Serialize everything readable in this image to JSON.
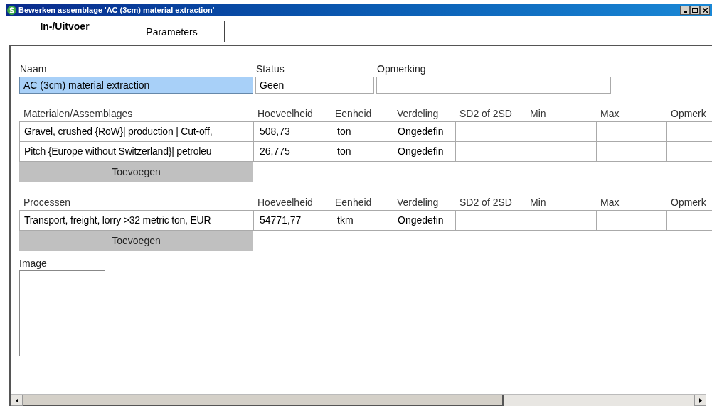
{
  "window": {
    "title": "Bewerken assemblage 'AC (3cm) material extraction'"
  },
  "tabs": [
    {
      "label": "In-/Uitvoer",
      "selected": true
    },
    {
      "label": "Parameters",
      "selected": false
    }
  ],
  "fields": [
    {
      "label": "Naam",
      "value": "AC (3cm) material extraction",
      "selected": true
    },
    {
      "label": "Status",
      "value": "Geen",
      "selected": false
    },
    {
      "label": "Opmerking",
      "selected": false
    }
  ],
  "sections": [
    {
      "columns": [
        "Materialen/Assemblages",
        "Hoeveelheid",
        "Eenheid",
        "Verdeling",
        "SD2 of 2SD",
        "Min",
        "Max",
        "Opmerk"
      ],
      "rows": [
        [
          "Gravel, crushed {RoW}| production | Cut-off,",
          "508,73",
          "ton",
          "Ongedefin"
        ],
        [
          "Pitch {Europe without Switzerland}| petroleu",
          "26,775",
          "ton",
          "Ongedefin"
        ]
      ],
      "button": "Toevoegen"
    },
    {
      "columns": [
        "Processen",
        "Hoeveelheid",
        "Eenheid",
        "Verdeling",
        "SD2 of 2SD",
        "Min",
        "Max",
        "Opmerk"
      ],
      "rows": [
        [
          "Transport, freight, lorry >32 metric ton, EUR",
          "54771,77",
          "tkm",
          "Ongedefin"
        ]
      ],
      "button": "Toevoegen"
    }
  ],
  "image": {
    "label": "Image"
  }
}
